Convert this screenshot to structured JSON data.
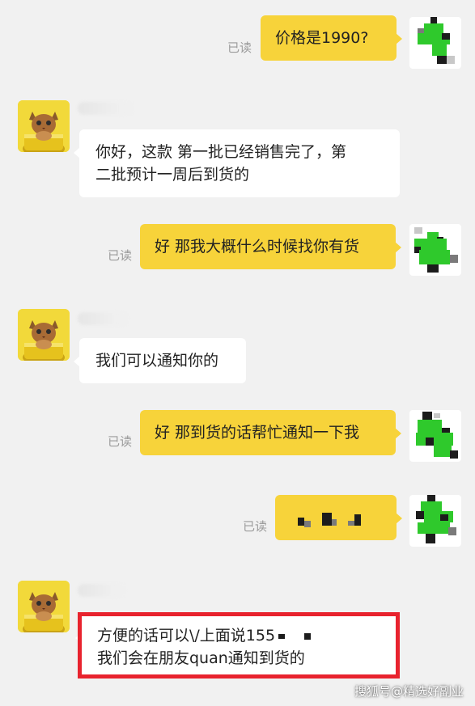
{
  "chat": {
    "read_label": "已读",
    "messages": [
      {
        "side": "out",
        "text": "价格是1990?",
        "read": "已读"
      },
      {
        "side": "in",
        "lines": [
          "你好，这款  第一批已经销售完了，第",
          "二批预计一周后到货的"
        ]
      },
      {
        "side": "out",
        "text": "好 那我大概什么时候找你有货",
        "read": "已读"
      },
      {
        "side": "in",
        "lines": [
          "我们可以通知你的"
        ]
      },
      {
        "side": "out",
        "text": "好 那到货的话帮忙通知一下我",
        "read": "已读"
      },
      {
        "side": "out",
        "text": "",
        "redacted": true,
        "read": "已读"
      },
      {
        "side": "in",
        "lines": [
          "方便的话可以\\/上面说155",
          "我们会在朋友quan通知到货的"
        ],
        "highlighted": true
      }
    ]
  },
  "watermark": "搜狐号@精选好副业",
  "colors": {
    "background": "#f1f1f1",
    "outgoing_bubble": "#f7d33a",
    "incoming_bubble": "#ffffff",
    "highlight": "#e8232e"
  },
  "icons": {
    "agent_avatar": "cat-avatar-icon",
    "user_avatar": "pixel-avatar-icon"
  }
}
